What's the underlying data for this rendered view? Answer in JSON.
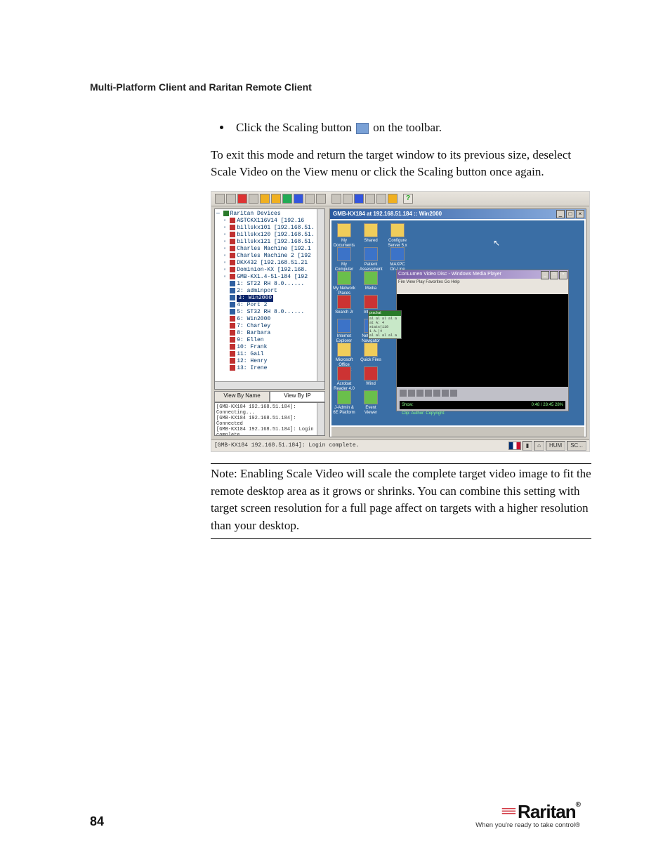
{
  "header": "Multi-Platform Client and Raritan Remote Client",
  "bullet": {
    "pre": "Click the Scaling button ",
    "post": " on the toolbar."
  },
  "para1": "To exit this mode and return the target window to its previous size, deselect Scale Video on the View menu or click the Scaling button once again.",
  "screenshot": {
    "tree_root": "Raritan Devices",
    "tree_items": [
      "ASTCKX116V14 [192.16",
      "billskx101 [192.168.51.",
      "billskx120 [192.168.51.",
      "billskx121 [192.168.51.",
      "Charles Machine [192.1",
      "Charles Machine 2 [192",
      "DKX432 [192.168.51.21",
      "Dominion-KX [192.168.",
      "GMB-KX1.4-51-184 [192"
    ],
    "ports": [
      "1: ST22 RH 8.0......",
      "2: adminport",
      "3: Win2000",
      "4: Port 2",
      "5: ST32 RH 8.0......",
      "6: Win2000",
      "7: Charley",
      "8: Barbara",
      "9: Ellen",
      "10: Frank",
      "11: Gail",
      "12: Henry",
      "13: Irene"
    ],
    "selected_index": 2,
    "tabs": [
      "View By Name",
      "View By IP"
    ],
    "active_tab": 1,
    "log": [
      "[GMB-KX184 192.168.51.184]:",
      "Connecting...",
      "[GMB-KX184 192.168.51.184]:",
      "Connected",
      "[GMB-KX184 192.168.51.184]: Login",
      "complete."
    ],
    "conn_title": "GMB-KX184 at 192.168.51.184 :: Win2000",
    "desktop_icons_col1": [
      "My Documents",
      "My Computer",
      "My Network Places",
      "Search Jr",
      "Internet Explorer",
      "Microsoft Office Outlook",
      "Acrobat Reader 4.0",
      "J-Admin & 6E Platform"
    ],
    "desktop_icons_col2": [
      "Shared",
      "Patient Assessment",
      "Media",
      "Internet",
      "Netscape Navigator",
      "Quick Files",
      "Wind",
      "Event Viewer"
    ],
    "desktop_icons_col3": [
      "Configure Server 5.x",
      "MAXPC On-Line"
    ],
    "media_title": "ConLumen Video Disc - Windows Media Player",
    "media_menu": "File  View  Play  Favorites  Go  Help",
    "media_info_left": "Show:",
    "media_info_labels": [
      "Clip:",
      "Author:",
      "Copyright:"
    ],
    "media_info_time": "0:48 / 28:45  28%",
    "small_win_title": "prachat",
    "small_lines": [
      "al al al al a",
      "at A: 4",
      "stats(110",
      "1 A.|4",
      "al al al al a"
    ],
    "status_left": "[GMB-KX184 192.168.51.184]: Login complete.",
    "status_right": [
      "HUM",
      "SC..."
    ]
  },
  "note": "Note: Enabling Scale Video will scale the complete target video image to fit the remote desktop area as it grows or shrinks. You can combine this setting with target screen resolution for a full page affect on targets with a higher resolution than your desktop.",
  "footer": {
    "page": "84",
    "brand": "Raritan",
    "tagline": "When you're ready to take control®"
  }
}
